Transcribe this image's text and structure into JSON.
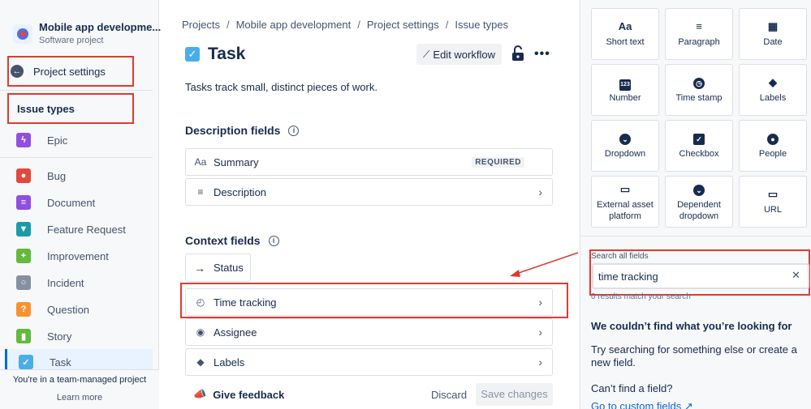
{
  "sidebar": {
    "project_name": "Mobile app developme...",
    "project_type": "Software project",
    "back_label": "Project settings",
    "section_heading": "Issue types",
    "items": [
      {
        "label": "Epic",
        "color": "#904ee2",
        "icon": "lightning-icon"
      },
      {
        "label": "Bug",
        "color": "#e2483d",
        "icon": "bug-icon"
      },
      {
        "label": "Document",
        "color": "#904ee2",
        "icon": "document-icon"
      },
      {
        "label": "Feature Request",
        "color": "#1d9aaa",
        "icon": "feature-icon"
      },
      {
        "label": "Improvement",
        "color": "#63ba3c",
        "icon": "plus-icon"
      },
      {
        "label": "Incident",
        "color": "#8590a2",
        "icon": "incident-icon"
      },
      {
        "label": "Question",
        "color": "#f79233",
        "icon": "question-icon"
      },
      {
        "label": "Story",
        "color": "#63ba3c",
        "icon": "bookmark-icon"
      },
      {
        "label": "Task",
        "color": "#4bade8",
        "icon": "check-icon"
      }
    ],
    "footer_text": "You're in a team-managed project",
    "learn_more": "Learn more"
  },
  "breadcrumbs": [
    "Projects",
    "Mobile app development",
    "Project settings",
    "Issue types"
  ],
  "issue": {
    "title": "Task",
    "description": "Tasks track small, distinct pieces of work.",
    "edit_workflow": "Edit workflow"
  },
  "description_fields": {
    "heading": "Description fields",
    "fields": [
      {
        "label": "Summary",
        "badge": "REQUIRED",
        "icon": "text-icon"
      },
      {
        "label": "Description",
        "icon": "lines-icon"
      }
    ]
  },
  "context_fields": {
    "heading": "Context fields",
    "status": "Status",
    "fields": [
      {
        "label": "Time tracking",
        "icon": "stopwatch-icon"
      },
      {
        "label": "Assignee",
        "icon": "person-icon"
      },
      {
        "label": "Labels",
        "icon": "tag-icon"
      }
    ]
  },
  "footer": {
    "feedback": "Give feedback",
    "discard": "Discard",
    "save": "Save changes"
  },
  "field_types": [
    {
      "label": "Short text",
      "icon": "short-text-icon",
      "glyph": "Aa"
    },
    {
      "label": "Paragraph",
      "icon": "paragraph-icon",
      "glyph": "≡"
    },
    {
      "label": "Date",
      "icon": "calendar-icon",
      "glyph": "▦"
    },
    {
      "label": "Number",
      "icon": "number-icon",
      "glyph": "123"
    },
    {
      "label": "Time stamp",
      "icon": "clock-icon",
      "glyph": "◷"
    },
    {
      "label": "Labels",
      "icon": "tag-icon",
      "glyph": "◆"
    },
    {
      "label": "Dropdown",
      "icon": "dropdown-icon",
      "glyph": "⌄"
    },
    {
      "label": "Checkbox",
      "icon": "checkbox-icon",
      "glyph": "✓"
    },
    {
      "label": "People",
      "icon": "people-icon",
      "glyph": "●"
    },
    {
      "label": "External asset platform",
      "icon": "monitor-icon",
      "glyph": "▭"
    },
    {
      "label": "Dependent dropdown",
      "icon": "dependent-dropdown-icon",
      "glyph": "⌄"
    },
    {
      "label": "URL",
      "icon": "url-icon",
      "glyph": "▭"
    }
  ],
  "search": {
    "label": "Search all fields",
    "value": "time tracking",
    "results": "0 results match your search",
    "not_found_title": "We couldn’t find what you’re looking for",
    "not_found_text": "Try searching for something else or create a new field.",
    "cant_find": "Can’t find a field?",
    "go_custom": "Go to custom fields ↗"
  }
}
